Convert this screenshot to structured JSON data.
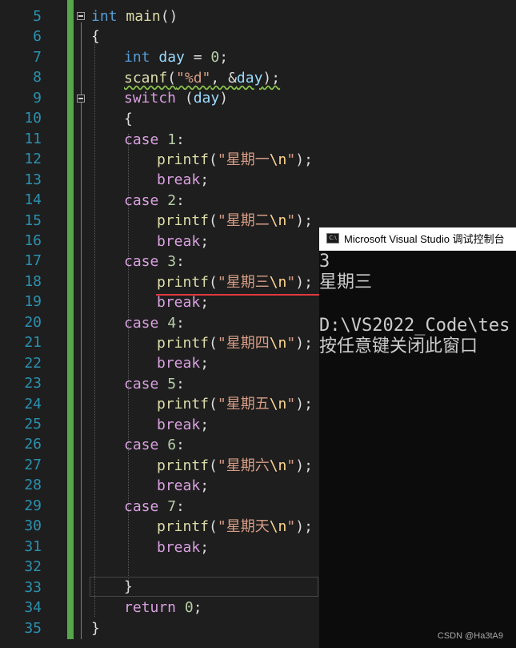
{
  "line_numbers": [
    "5",
    "6",
    "7",
    "8",
    "9",
    "10",
    "11",
    "12",
    "13",
    "14",
    "15",
    "16",
    "17",
    "18",
    "19",
    "20",
    "21",
    "22",
    "23",
    "24",
    "25",
    "26",
    "27",
    "28",
    "29",
    "30",
    "31",
    "32",
    "33",
    "34",
    "35"
  ],
  "code": {
    "l5": {
      "kw": "int",
      "fn": "main",
      "rest": "()"
    },
    "l6": "{",
    "l7": {
      "kw": "int",
      "var": "day",
      "op": " = ",
      "num": "0",
      "end": ";"
    },
    "l8": {
      "fn": "scanf",
      "p1": "(",
      "str": "\"%d\"",
      "comma": ", &",
      "var": "day",
      "end": ");"
    },
    "l9": {
      "ctl": "switch",
      "p1": " (",
      "var": "day",
      "end": ")"
    },
    "l10": "{",
    "cases": [
      {
        "case": "case",
        "num": "1",
        "str1": "\"星期一",
        "esc": "\\n",
        "str2": "\""
      },
      {
        "case": "case",
        "num": "2",
        "str1": "\"星期二",
        "esc": "\\n",
        "str2": "\""
      },
      {
        "case": "case",
        "num": "3",
        "str1": "\"星期三",
        "esc": "\\n",
        "str2": "\""
      },
      {
        "case": "case",
        "num": "4",
        "str1": "\"星期四",
        "esc": "\\n",
        "str2": "\""
      },
      {
        "case": "case",
        "num": "5",
        "str1": "\"星期五",
        "esc": "\\n",
        "str2": "\""
      },
      {
        "case": "case",
        "num": "6",
        "str1": "\"星期六",
        "esc": "\\n",
        "str2": "\""
      },
      {
        "case": "case",
        "num": "7",
        "str1": "\"星期天",
        "esc": "\\n",
        "str2": "\""
      }
    ],
    "printf": "printf",
    "break": "break",
    "colon": ":",
    "semi": ";",
    "lparen": "(",
    "rparen": ");",
    "l33": "}",
    "l34": {
      "ctl": "return",
      "num": "0",
      "end": ";"
    },
    "l35": "}"
  },
  "console": {
    "title": "Microsoft Visual Studio 调试控制台",
    "icon_label": "C:\\",
    "lines": [
      "3",
      "星期三",
      "",
      "D:\\VS2022_Code\\tes",
      "按任意键关闭此窗口"
    ]
  },
  "watermark": "CSDN @Ha3tA9",
  "colors": {
    "background": "#1e1e1e",
    "line_number": "#2b91af",
    "keyword": "#569cd6",
    "control": "#d8a0df",
    "string": "#d69d85",
    "change_bar": "#57a64a",
    "annotation_underline": "#e0383e"
  }
}
